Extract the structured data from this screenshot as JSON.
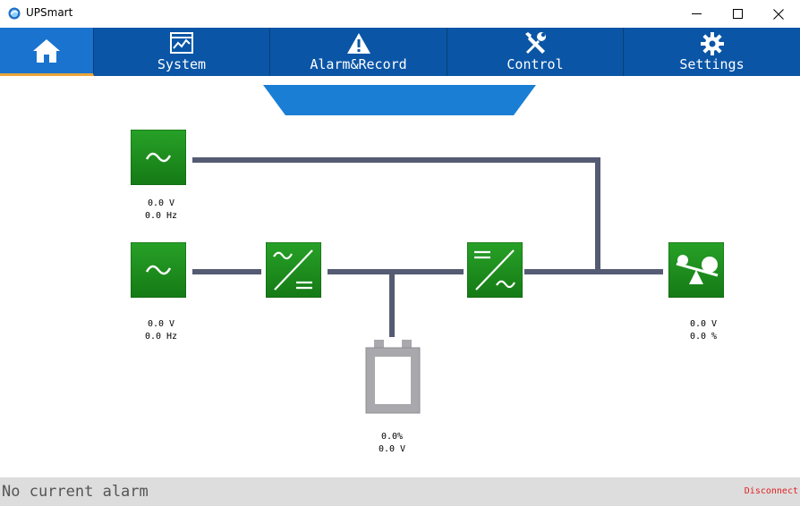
{
  "window": {
    "title": "UPSmart"
  },
  "nav": {
    "items": [
      {
        "id": "home",
        "label": "",
        "icon": "home-icon"
      },
      {
        "id": "system",
        "label": "System",
        "icon": "chart-window-icon"
      },
      {
        "id": "alarm",
        "label": "Alarm&Record",
        "icon": "warning-icon"
      },
      {
        "id": "control",
        "label": "Control",
        "icon": "wrench-screwdriver-icon"
      },
      {
        "id": "settings",
        "label": "Settings",
        "icon": "gear-icon"
      }
    ],
    "active": "home",
    "colors": {
      "bar": "#0a55a6",
      "active": "#1a73cf",
      "active_underline": "#e8a33a"
    }
  },
  "diagram": {
    "colors": {
      "block": "#1e8a1e",
      "line": "#545b72",
      "battery": "#a9a9ad",
      "banner": "#1a7fd4"
    },
    "bypass_input": {
      "voltage": "0.0 V",
      "frequency": "0.0 Hz",
      "icon": "ac-sine-icon"
    },
    "main_input": {
      "voltage": "0.0 V",
      "frequency": "0.0 Hz",
      "icon": "ac-sine-icon"
    },
    "rectifier": {
      "icon": "ac-to-dc-icon"
    },
    "inverter": {
      "icon": "dc-to-ac-icon"
    },
    "battery": {
      "capacity": "0.0%",
      "voltage": "0.0 V",
      "icon": "battery-icon"
    },
    "output": {
      "voltage": "0.0 V",
      "load": "0.0 %",
      "icon": "load-balance-icon"
    }
  },
  "status": {
    "alarm": "No current alarm",
    "connection": "Disconnect"
  }
}
